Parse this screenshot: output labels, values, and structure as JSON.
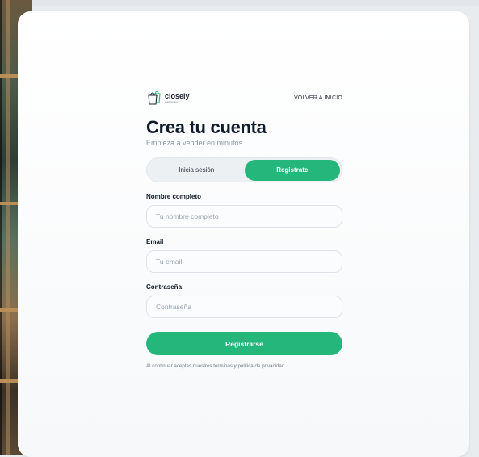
{
  "brand": {
    "name": "closely",
    "tagline": "marketplace",
    "logo_icon": "shopping-bag-icon"
  },
  "header": {
    "back_link": "VOLVER A INICIO"
  },
  "page": {
    "title": "Crea tu cuenta",
    "subtitle": "Empieza a vender en minutos."
  },
  "auth_toggle": {
    "options": [
      {
        "label": "Inicia sesión",
        "active": false
      },
      {
        "label": "Registrate",
        "active": true
      }
    ]
  },
  "form": {
    "fields": [
      {
        "label": "Nombre completo",
        "placeholder": "Tu nombre completo",
        "value": ""
      },
      {
        "label": "Email",
        "placeholder": "Tu email",
        "value": ""
      },
      {
        "label": "Contraseña",
        "placeholder": "Contraseña",
        "value": ""
      }
    ],
    "submit_label": "Registrarse",
    "legal_text": "Al continuar aceptas nuestros terminos y politica de privacidad."
  },
  "colors": {
    "accent": "#24b67a",
    "title": "#0f1b2d",
    "muted": "#8a96a3"
  }
}
